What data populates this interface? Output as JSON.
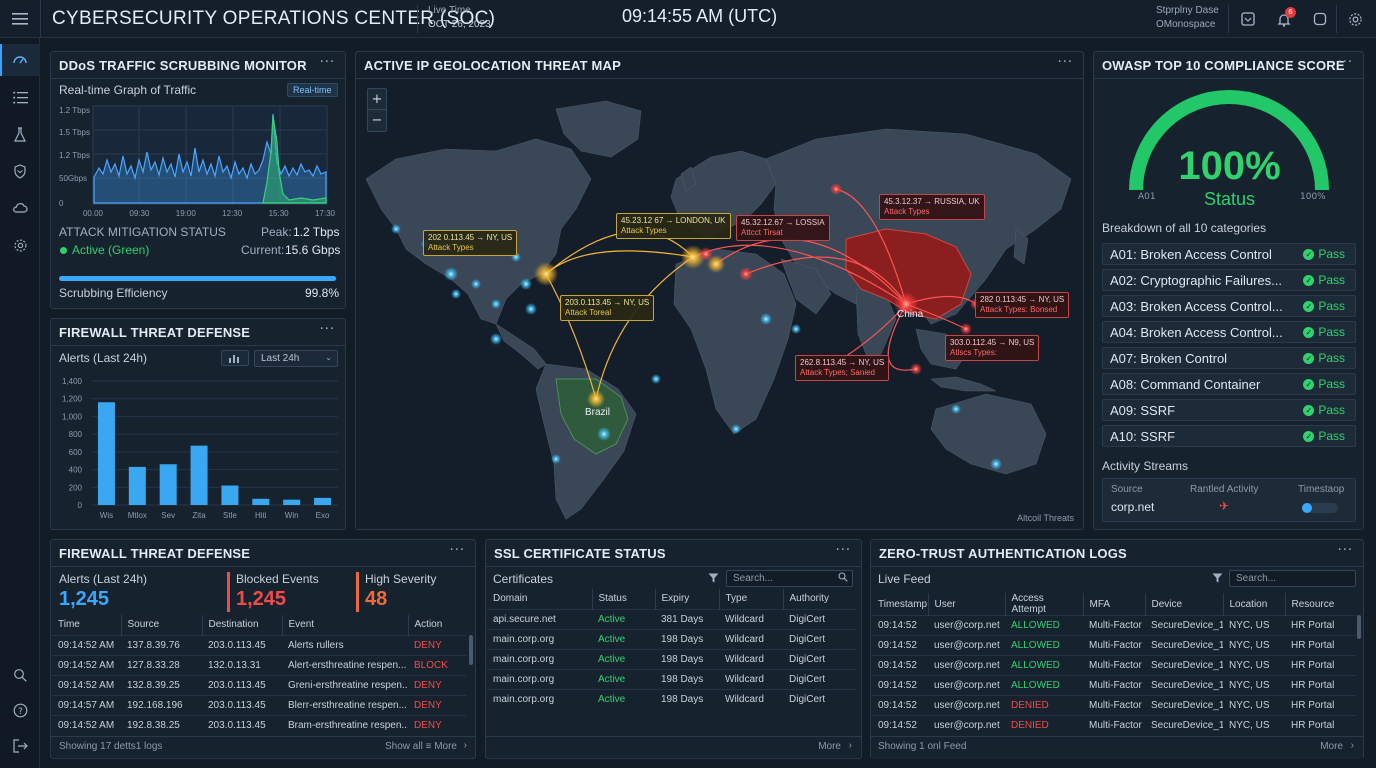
{
  "header": {
    "title": "CYBERSECURITY OPERATIONS CENTER (SOC)",
    "live_label": "Live Time",
    "date": "OCT 26, 2023",
    "clock": "09:14:55 AM (UTC)",
    "user_line1": "Stprplny Dase",
    "user_line2": "OMonospace",
    "notification_count": "6"
  },
  "sidebar": {
    "items": [
      "dashboard-icon",
      "list-icon",
      "flask-icon",
      "shield-icon",
      "cloud-icon",
      "gear-icon"
    ],
    "bottom": [
      "search-user-icon",
      "help-icon",
      "logout-icon"
    ]
  },
  "ddos": {
    "title": "DDoS TRAFFIC SCRUBBING MONITOR",
    "graph_title": "Real-time Graph of Traffic",
    "realtime_badge": "Real-time",
    "y_ticks": [
      "1.2 Tbps",
      "1.5 Tbps",
      "1.2 Tbps",
      "50Gbps",
      "0"
    ],
    "x_ticks": [
      "00.00",
      "09:30",
      "19:00",
      "12:30",
      "15:30",
      "17:30"
    ],
    "mitigation_label": "ATTACK MITIGATION STATUS",
    "peak_label": "Peak:",
    "peak_value": "1.2 Tbps",
    "status": "Active (Green)",
    "current_label": "Current:",
    "current_value": "15.6 Gbps",
    "efficiency_label": "Scrubbing Efficiency",
    "efficiency_value": "99.8%",
    "efficiency_fraction": 0.998
  },
  "firewall_chart": {
    "title": "FIREWALL THREAT DEFENSE",
    "alerts_label": "Alerts (Last 24h)",
    "range_select": "Last 24h",
    "chart_data": {
      "type": "bar",
      "categories": [
        "Wis",
        "Mtlox",
        "Sev",
        "Zita",
        "Stle",
        "Hiti",
        "Win",
        "Exo"
      ],
      "values": [
        1160,
        430,
        460,
        670,
        220,
        70,
        60,
        80
      ],
      "y_tick_labels": [
        "1,400",
        "1,200",
        "1,000",
        "800",
        "600",
        "400",
        "200",
        "0"
      ],
      "ylim": [
        0,
        1400
      ]
    }
  },
  "map": {
    "title": "ACTIVE IP GEOLOCATION THREAT MAP",
    "zoom_in": "+",
    "zoom_out": "−",
    "footer": "Altcoil Threats",
    "region_labels": [
      "China",
      "Brazil"
    ],
    "labels": [
      {
        "line1": "202 0.113.45 → NY, US",
        "line2": "Attack Types",
        "color": "yellow"
      },
      {
        "line1": "45.23.12 67 → LONDON, UK",
        "line2": "Attack Types",
        "color": "yellow"
      },
      {
        "line1": "45.32.12.67 → LOSSIA",
        "line2": "Attcct Tirsat",
        "color": "red"
      },
      {
        "line1": "45.3.12.37 → RUSSIA, UK",
        "line2": "Attack Types",
        "color": "red"
      },
      {
        "line1": "203.0.113.45 → NY, US",
        "line2": "Attack Toreal",
        "color": "yellow"
      },
      {
        "line1": "282 0.113:45 → NY, US",
        "line2": "Attack Types: Bonsed",
        "color": "red"
      },
      {
        "line1": "303.0.112.45 → N9, US",
        "line2": "Atlscs Types:",
        "color": "red"
      },
      {
        "line1": "262.8.113.45 → NY, US",
        "line2": "Attack Types; Sanied",
        "color": "red"
      }
    ]
  },
  "owasp": {
    "title": "OWASP TOP 10 COMPLIANCE SCORE",
    "score": "100%",
    "score_fraction": 1.0,
    "score_label": "Status",
    "gauge_min": "A01",
    "gauge_max": "100%",
    "breakdown_label": "Breakdown of all 10 categories",
    "items": [
      {
        "name": "A01: Broken Access Control",
        "status": "Pass"
      },
      {
        "name": "A02: Cryptographic Failures...",
        "status": "Pass"
      },
      {
        "name": "A03: Broken Access Control...",
        "status": "Pass"
      },
      {
        "name": "A04: Broken Access Control...",
        "status": "Pass"
      },
      {
        "name": "A07: Broken Control",
        "status": "Pass"
      },
      {
        "name": "A08: Command Container",
        "status": "Pass"
      },
      {
        "name": "A09: SSRF",
        "status": "Pass"
      },
      {
        "name": "A10: SSRF",
        "status": "Pass"
      }
    ],
    "activity_label": "Activity Streams",
    "activity_cols": [
      "Source",
      "Rantled Activity",
      "Timestaop"
    ],
    "activity_source": "corp.net"
  },
  "firewall_log": {
    "title": "FIREWALL THREAT DEFENSE",
    "alerts_label": "Alerts (Last 24h)",
    "alerts_value": "1,245",
    "blocked_label": "Blocked Events",
    "blocked_value": "1,245",
    "severity_label": "High Severity",
    "severity_value": "48",
    "columns": [
      "Time",
      "Source",
      "Destination",
      "Event",
      "Action"
    ],
    "rows": [
      {
        "time": "09:14:52 AM",
        "source": "137.8.39.76",
        "dest": "203.0.113.45",
        "event": "Alerts rullers",
        "action": "DENY"
      },
      {
        "time": "09:14:52 AM",
        "source": "127.8.33.28",
        "dest": "132.0.13.31",
        "event": "Alert-ersthreatine respen...",
        "action": "BLOCK"
      },
      {
        "time": "09:14:52 AM",
        "source": "132.8.39.25",
        "dest": "203.0.113.45",
        "event": "Greni-ersthreatine respen...",
        "action": "DENY"
      },
      {
        "time": "09:14:57 AM",
        "source": "192.168.196",
        "dest": "203.0.113.45",
        "event": "Blerr-ersthreatine respen...",
        "action": "DENY"
      },
      {
        "time": "09:14:52 AM",
        "source": "192.8.38.25",
        "dest": "203.0.113.45",
        "event": "Bram-ersthreatine respen...",
        "action": "DENY"
      }
    ],
    "footer_left": "Showing 17 detts1 logs",
    "footer_right": "Show all ≡ More"
  },
  "ssl": {
    "title": "SSL CERTIFICATE STATUS",
    "subtitle": "Certificates",
    "search_placeholder": "Search...",
    "columns": [
      "Domain",
      "Status",
      "Expiry",
      "Type",
      "Authority"
    ],
    "rows": [
      {
        "domain": "api.secure.net",
        "status": "Active",
        "expiry": "381 Days",
        "type": "Wildcard",
        "authority": "DigiCert"
      },
      {
        "domain": "main.corp.org",
        "status": "Active",
        "expiry": "198 Days",
        "type": "Wildcard",
        "authority": "DigiCert"
      },
      {
        "domain": "main.corp.org",
        "status": "Active",
        "expiry": "198 Days",
        "type": "Wildcard",
        "authority": "DigiCert"
      },
      {
        "domain": "main.corp.org",
        "status": "Active",
        "expiry": "198 Days",
        "type": "Wildcard",
        "authority": "DigiCert"
      },
      {
        "domain": "main.corp.org",
        "status": "Active",
        "expiry": "198 Days",
        "type": "Wildcard",
        "authority": "DigiCert"
      }
    ],
    "footer_right": "More"
  },
  "zt": {
    "title": "ZERO-TRUST AUTHENTICATION LOGS",
    "subtitle": "Live Feed",
    "search_placeholder": "Search...",
    "columns": [
      "Timestamp",
      "User",
      "Access Attempt",
      "MFA",
      "Device",
      "Location",
      "Resource"
    ],
    "rows": [
      {
        "ts": "09:14:52",
        "user": "user@corp.net",
        "access": "ALLOWED",
        "mfa": "Multi-Factor",
        "device": "SecureDevice_1",
        "loc": "NYC, US",
        "res": "HR Portal"
      },
      {
        "ts": "09:14:52",
        "user": "user@corp.net",
        "access": "ALLOWED",
        "mfa": "Multi-Factor",
        "device": "SecureDevice_1",
        "loc": "NYC, US",
        "res": "HR Portal"
      },
      {
        "ts": "09:14:52",
        "user": "user@corp.net",
        "access": "ALLOWED",
        "mfa": "Multi-Factor",
        "device": "SecureDevice_1",
        "loc": "NYC, US",
        "res": "HR Portal"
      },
      {
        "ts": "09:14:52",
        "user": "user@corp.net",
        "access": "ALLOWED",
        "mfa": "Multi-Factor",
        "device": "SecureDevice_1",
        "loc": "NYC, US",
        "res": "HR Portal"
      },
      {
        "ts": "09:14:52",
        "user": "user@corp.net",
        "access": "DENIED",
        "mfa": "Multi-Factor",
        "device": "SecureDevice_1",
        "loc": "NYC, US",
        "res": "HR Portal"
      },
      {
        "ts": "09:14:52",
        "user": "user@corp.net",
        "access": "DENIED",
        "mfa": "Multi-Factor",
        "device": "SecureDevice_1",
        "loc": "NYC, US",
        "res": "HR Portal"
      }
    ],
    "footer_left": "Showing 1 onl Feed",
    "footer_right": "More"
  }
}
